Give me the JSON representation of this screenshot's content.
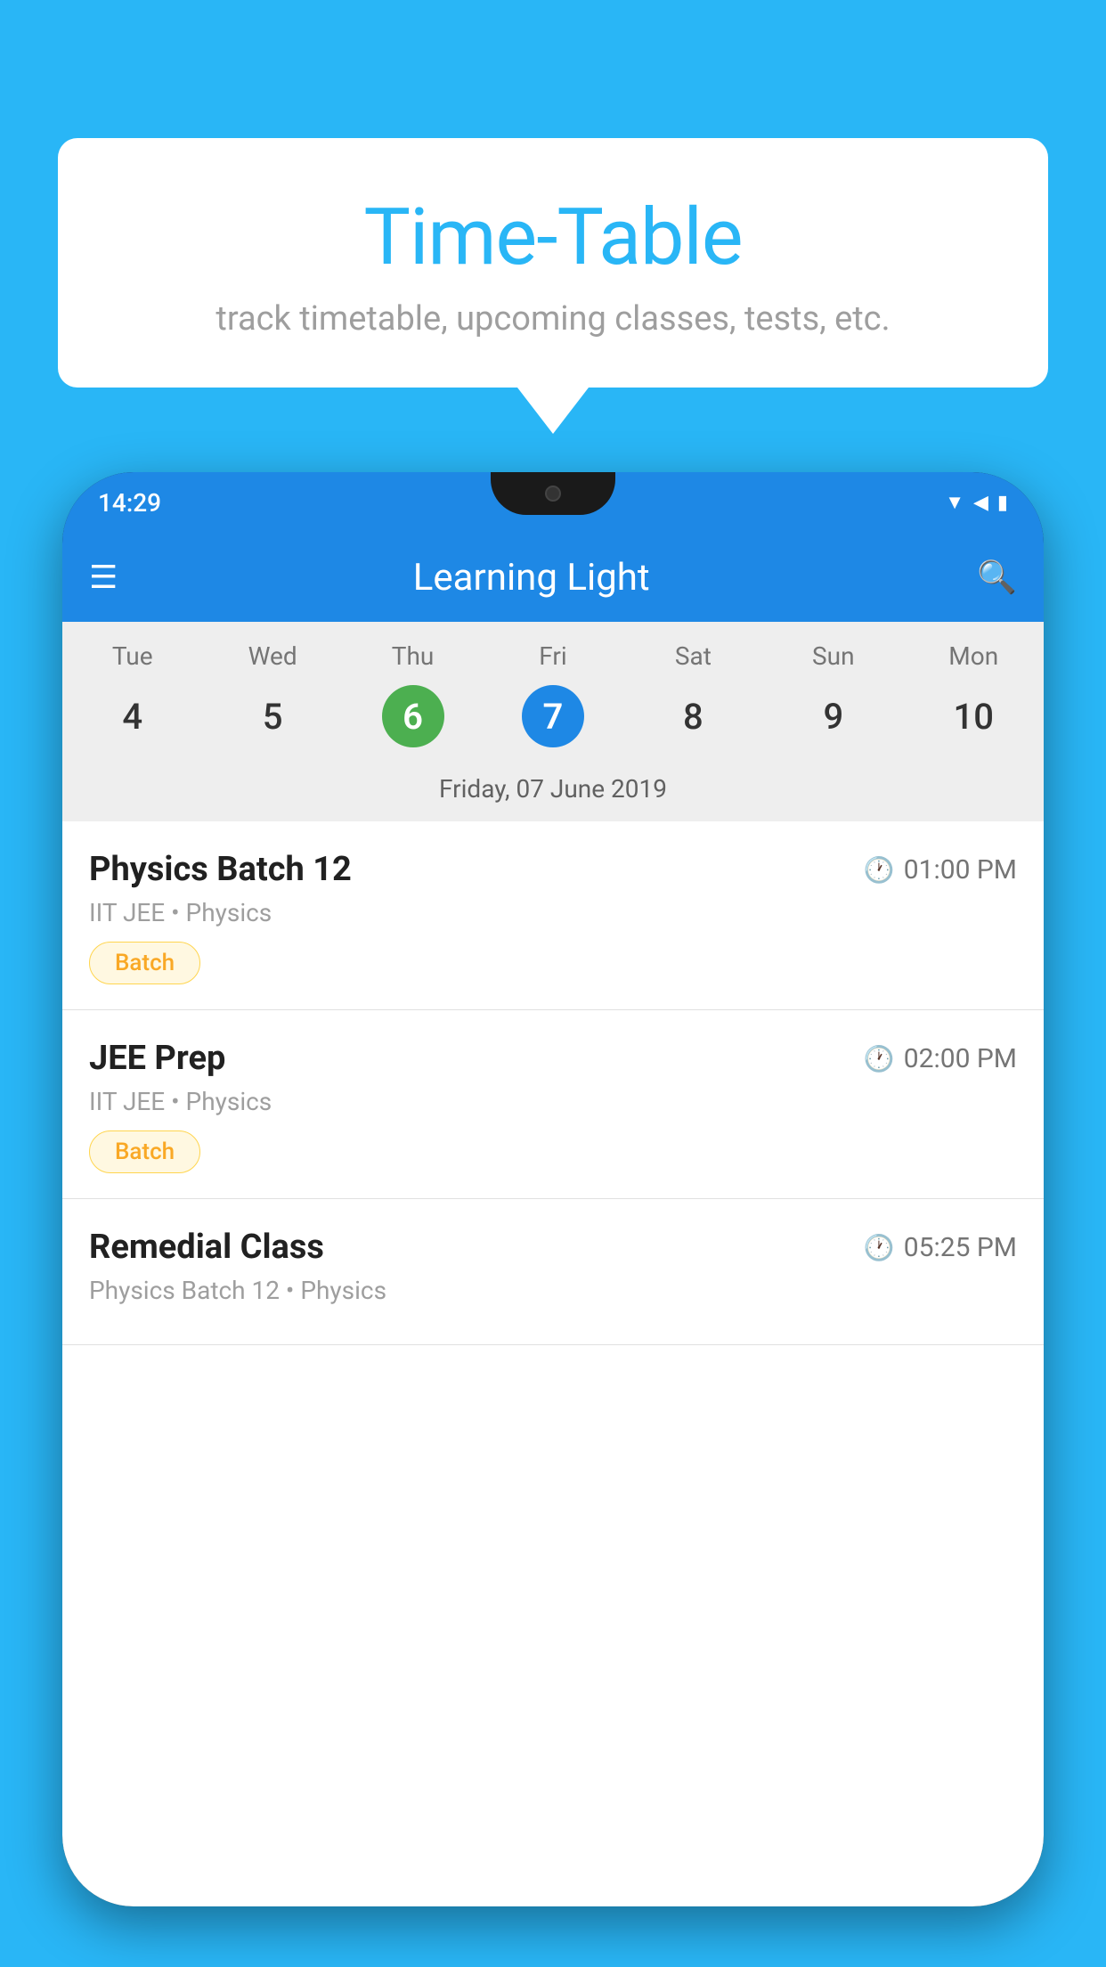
{
  "background_color": "#29B6F6",
  "speech_bubble": {
    "title": "Time-Table",
    "subtitle": "track timetable, upcoming classes, tests, etc."
  },
  "phone": {
    "status_bar": {
      "time": "14:29",
      "icons": [
        "wifi",
        "signal",
        "battery"
      ]
    },
    "app_bar": {
      "title": "Learning Light"
    },
    "calendar": {
      "days": [
        "Tue",
        "Wed",
        "Thu",
        "Fri",
        "Sat",
        "Sun",
        "Mon"
      ],
      "dates": [
        "4",
        "5",
        "6",
        "7",
        "8",
        "9",
        "10"
      ],
      "today_index": 2,
      "selected_index": 3,
      "selected_label": "Friday, 07 June 2019"
    },
    "schedule_items": [
      {
        "title": "Physics Batch 12",
        "time": "01:00 PM",
        "subtitle": "IIT JEE • Physics",
        "badge": "Batch"
      },
      {
        "title": "JEE Prep",
        "time": "02:00 PM",
        "subtitle": "IIT JEE • Physics",
        "badge": "Batch"
      },
      {
        "title": "Remedial Class",
        "time": "05:25 PM",
        "subtitle": "Physics Batch 12 • Physics",
        "badge": null
      }
    ]
  }
}
